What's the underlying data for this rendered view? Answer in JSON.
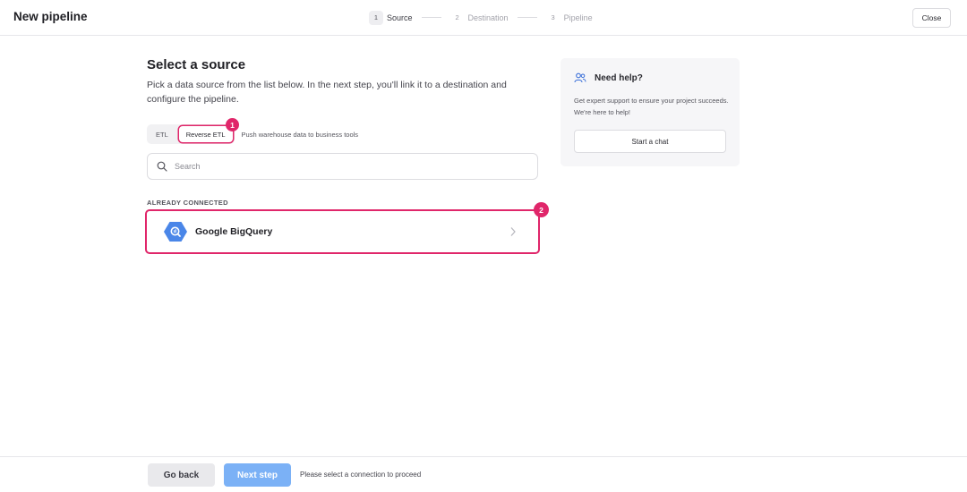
{
  "header": {
    "title": "New pipeline",
    "close_label": "Close",
    "steps": [
      {
        "num": "1",
        "label": "Source",
        "active": true
      },
      {
        "num": "2",
        "label": "Destination",
        "active": false
      },
      {
        "num": "3",
        "label": "Pipeline",
        "active": false
      }
    ]
  },
  "main": {
    "title": "Select a source",
    "description": "Pick a data source from the list below. In the next step, you'll link it to a destination and configure the pipeline.",
    "tabs": [
      {
        "label": "ETL",
        "selected": false
      },
      {
        "label": "Reverse ETL",
        "selected": true
      }
    ],
    "tab_hint": "Push warehouse data to business tools",
    "search": {
      "placeholder": "Search",
      "value": ""
    },
    "section_label": "ALREADY CONNECTED",
    "connections": [
      {
        "name": "Google BigQuery",
        "icon": "bigquery-icon"
      }
    ],
    "badges": [
      "1",
      "2"
    ]
  },
  "help": {
    "title": "Need help?",
    "body": "Get expert support to ensure your project succeeds. We're here to help!",
    "chat_label": "Start a chat"
  },
  "footer": {
    "back_label": "Go back",
    "next_label": "Next step",
    "hint": "Please select a connection to proceed"
  },
  "colors": {
    "highlight": "#e0266a",
    "primary_disabled": "#7bb1f6",
    "bigquery": "#4a86e8"
  }
}
